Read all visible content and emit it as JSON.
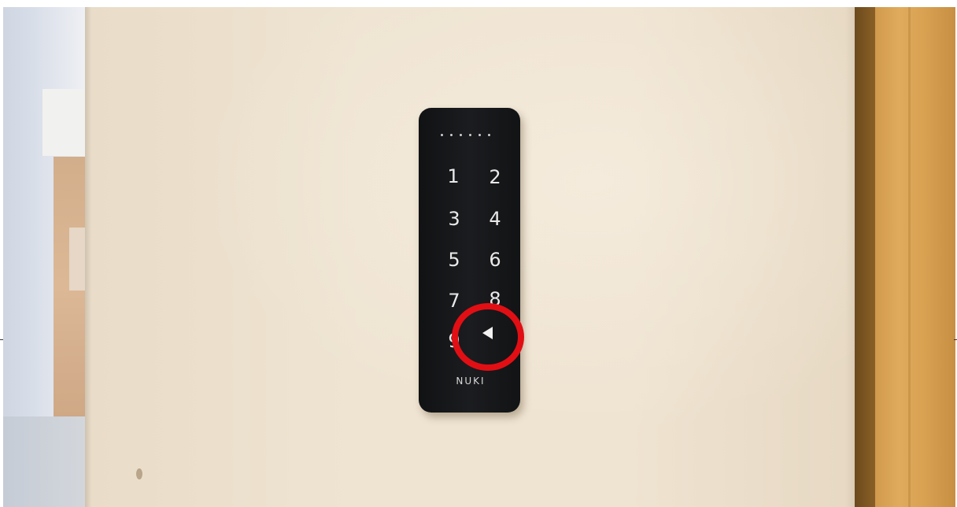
{
  "keypad": {
    "brand_label": "NUKI",
    "keys": [
      "1",
      "2",
      "3",
      "4",
      "5",
      "6",
      "7",
      "8",
      "9"
    ],
    "confirm_icon": "left-triangle-icon"
  },
  "annotation": {
    "highlight_color": "#e10f14",
    "highlight_target": "arrow-key"
  }
}
